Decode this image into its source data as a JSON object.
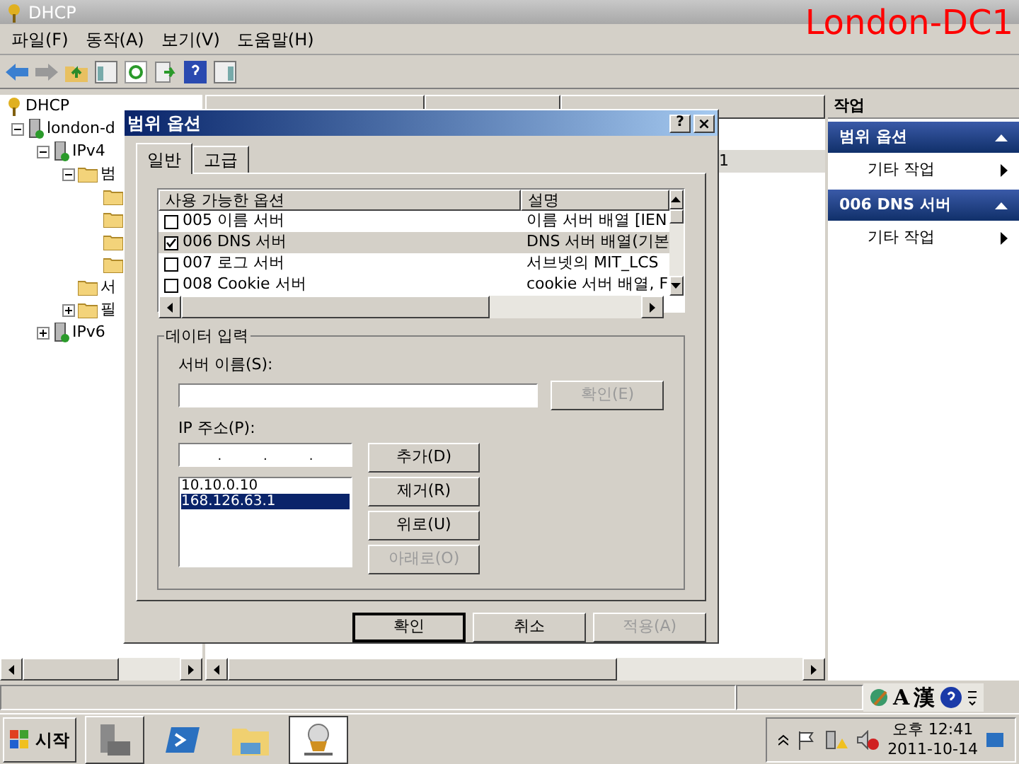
{
  "window": {
    "title": "DHCP"
  },
  "overlay_label": "London-DC1",
  "menu": [
    "파일(F)",
    "동작(A)",
    "보기(V)",
    "도움말(H)"
  ],
  "tree": [
    {
      "label": "DHCP",
      "children": [
        {
          "label": "london-d",
          "expanded": true,
          "children": [
            {
              "label": "IPv4",
              "expanded": true,
              "children": [
                {
                  "label": "범",
                  "expanded": true,
                  "children": [
                    {
                      "kind": "folder"
                    },
                    {
                      "kind": "folder"
                    },
                    {
                      "kind": "folder"
                    },
                    {
                      "kind": "folder"
                    }
                  ]
                },
                {
                  "label": "서"
                },
                {
                  "label": "필",
                  "expanded": false
                }
              ]
            },
            {
              "label": "IPv6",
              "expanded": false
            }
          ]
        }
      ]
    }
  ],
  "list": {
    "rows": [
      {
        "selected": false
      },
      {
        "column_3": "1",
        "selected": true
      },
      {
        "selected": false
      }
    ]
  },
  "actions": {
    "header": "작업",
    "sections": [
      {
        "title": "범위 옵션",
        "item": "기타 작업"
      },
      {
        "title": "006 DNS 서버",
        "item": "기타 작업"
      }
    ]
  },
  "dialog": {
    "title": "범위 옵션",
    "help": "?",
    "close": "×",
    "tabs": [
      {
        "label": "일반",
        "selected": true
      },
      {
        "label": "고급",
        "selected": false
      }
    ],
    "options": {
      "columns": [
        "사용 가능한 옵션",
        "설명"
      ],
      "rows": [
        {
          "name": "005 이름 서버",
          "description": "이름 서버 배열 [IEN",
          "checked": false,
          "selected": false
        },
        {
          "name": "006 DNS 서버",
          "description": "DNS 서버 배열(기본",
          "checked": true,
          "selected": true
        },
        {
          "name": "007 로그 서버",
          "description": "서브넷의 MIT_LCS",
          "checked": false,
          "selected": false
        },
        {
          "name": "008 Cookie 서버",
          "description": "cookie 서버 배열, F",
          "checked": false,
          "selected": false
        }
      ]
    },
    "group_title": "데이터 입력",
    "server_label": "서버 이름(S):",
    "resolve_button": {
      "label": "확인(E)",
      "disabled": true
    },
    "ip_label": "IP 주소(P):",
    "ip_separators": [
      ".",
      ".",
      "."
    ],
    "ip_list": [
      {
        "value": "10.10.0.10",
        "selected": false
      },
      {
        "value": "168.126.63.1",
        "selected": true
      }
    ],
    "side_buttons": [
      {
        "label": "추가(D)",
        "disabled": false
      },
      {
        "label": "제거(R)",
        "disabled": false
      },
      {
        "label": "위로(U)",
        "disabled": false
      },
      {
        "label": "아래로(O)",
        "disabled": true
      }
    ],
    "footer_buttons": [
      {
        "label": "확인",
        "disabled": false,
        "default": true
      },
      {
        "label": "취소",
        "disabled": false,
        "default": false
      },
      {
        "label": "적용(A)",
        "disabled": true,
        "default": false
      }
    ]
  },
  "language_bar": [
    "A",
    "漢"
  ],
  "taskbar": {
    "start": "시작",
    "time": "오후 12:41",
    "date": "2011-10-14"
  }
}
